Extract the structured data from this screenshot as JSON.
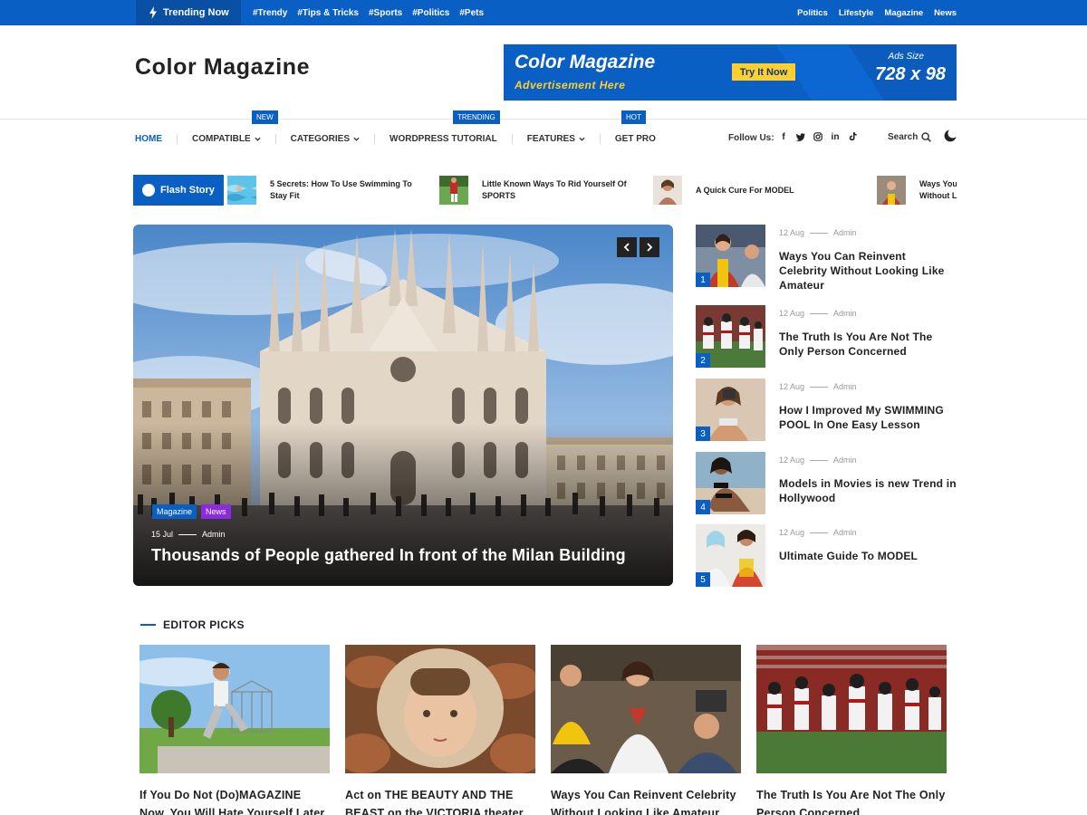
{
  "topbar": {
    "trending_label": "Trending Now",
    "tags": [
      "#Trendy",
      "#Tips & Tricks",
      "#Sports",
      "#Politics",
      "#Pets"
    ],
    "links": [
      "Politics",
      "Lifestyle",
      "Magazine",
      "News"
    ]
  },
  "header": {
    "logo": "Color Magazine",
    "ad": {
      "title": "Color Magazine",
      "subtitle": "Advertisement Here",
      "button": "Try It Now",
      "size_label": "Ads Size",
      "size": "728 x 98"
    }
  },
  "nav": {
    "items": [
      {
        "label": "HOME",
        "active": true,
        "dropdown": false
      },
      {
        "label": "COMPATIBLE",
        "active": false,
        "dropdown": true,
        "badge": "NEW"
      },
      {
        "label": "CATEGORIES",
        "active": false,
        "dropdown": true
      },
      {
        "label": "WORDPRESS TUTORIAL",
        "active": false,
        "dropdown": false
      },
      {
        "label": "FEATURES",
        "active": false,
        "dropdown": true,
        "badge": "TRENDING"
      },
      {
        "label": "GET PRO",
        "active": false,
        "dropdown": false,
        "badge": "HOT"
      }
    ],
    "follow_label": "Follow Us:",
    "social": [
      "facebook-icon",
      "twitter-icon",
      "instagram-icon",
      "linkedin-icon",
      "tiktok-icon"
    ],
    "search_label": "Search"
  },
  "flash": {
    "label": "Flash Story",
    "items": [
      "5 Secrets: How To Use Swimming To Stay Fit",
      "Little Known Ways To Rid Yourself Of SPORTS",
      "A Quick Cure For MODEL",
      "Ways You Can Reinvent Celebrity Without Looking Like Amateur"
    ]
  },
  "hero": {
    "categories": [
      {
        "label": "Magazine",
        "color": "#0a5fc4"
      },
      {
        "label": "News",
        "color": "#8a2be2"
      }
    ],
    "date": "15 Jul",
    "author": "Admin",
    "title": "Thousands of People gathered In front of the Milan Building"
  },
  "sidebar": {
    "items": [
      {
        "num": "1",
        "date": "12 Aug",
        "author": "Admin",
        "title": "Ways You Can Reinvent Celebrity Without Looking Like Amateur"
      },
      {
        "num": "2",
        "date": "12 Aug",
        "author": "Admin",
        "title": "The Truth Is You Are Not The Only Person Concerned"
      },
      {
        "num": "3",
        "date": "12 Aug",
        "author": "Admin",
        "title": "How I Improved My SWIMMING POOL In One Easy Lesson"
      },
      {
        "num": "4",
        "date": "12 Aug",
        "author": "Admin",
        "title": "Models in Movies is new Trend in Hollywood"
      },
      {
        "num": "5",
        "date": "12 Aug",
        "author": "Admin",
        "title": "Ultimate Guide To MODEL"
      }
    ]
  },
  "editor_picks": {
    "heading": "EDITOR PICKS",
    "items": [
      {
        "title": "If You Do Not (Do)MAGAZINE Now, You Will Hate Yourself Later"
      },
      {
        "title": "Act on THE BEAUTY AND THE BEAST on the VICTORIA theater."
      },
      {
        "title": "Ways You Can Reinvent Celebrity Without Looking Like Amateur"
      },
      {
        "title": "The Truth Is You Are Not The Only Person Concerned"
      }
    ]
  },
  "colors": {
    "accent": "#0a5fc4",
    "ad_yellow": "#ffcf2e"
  }
}
